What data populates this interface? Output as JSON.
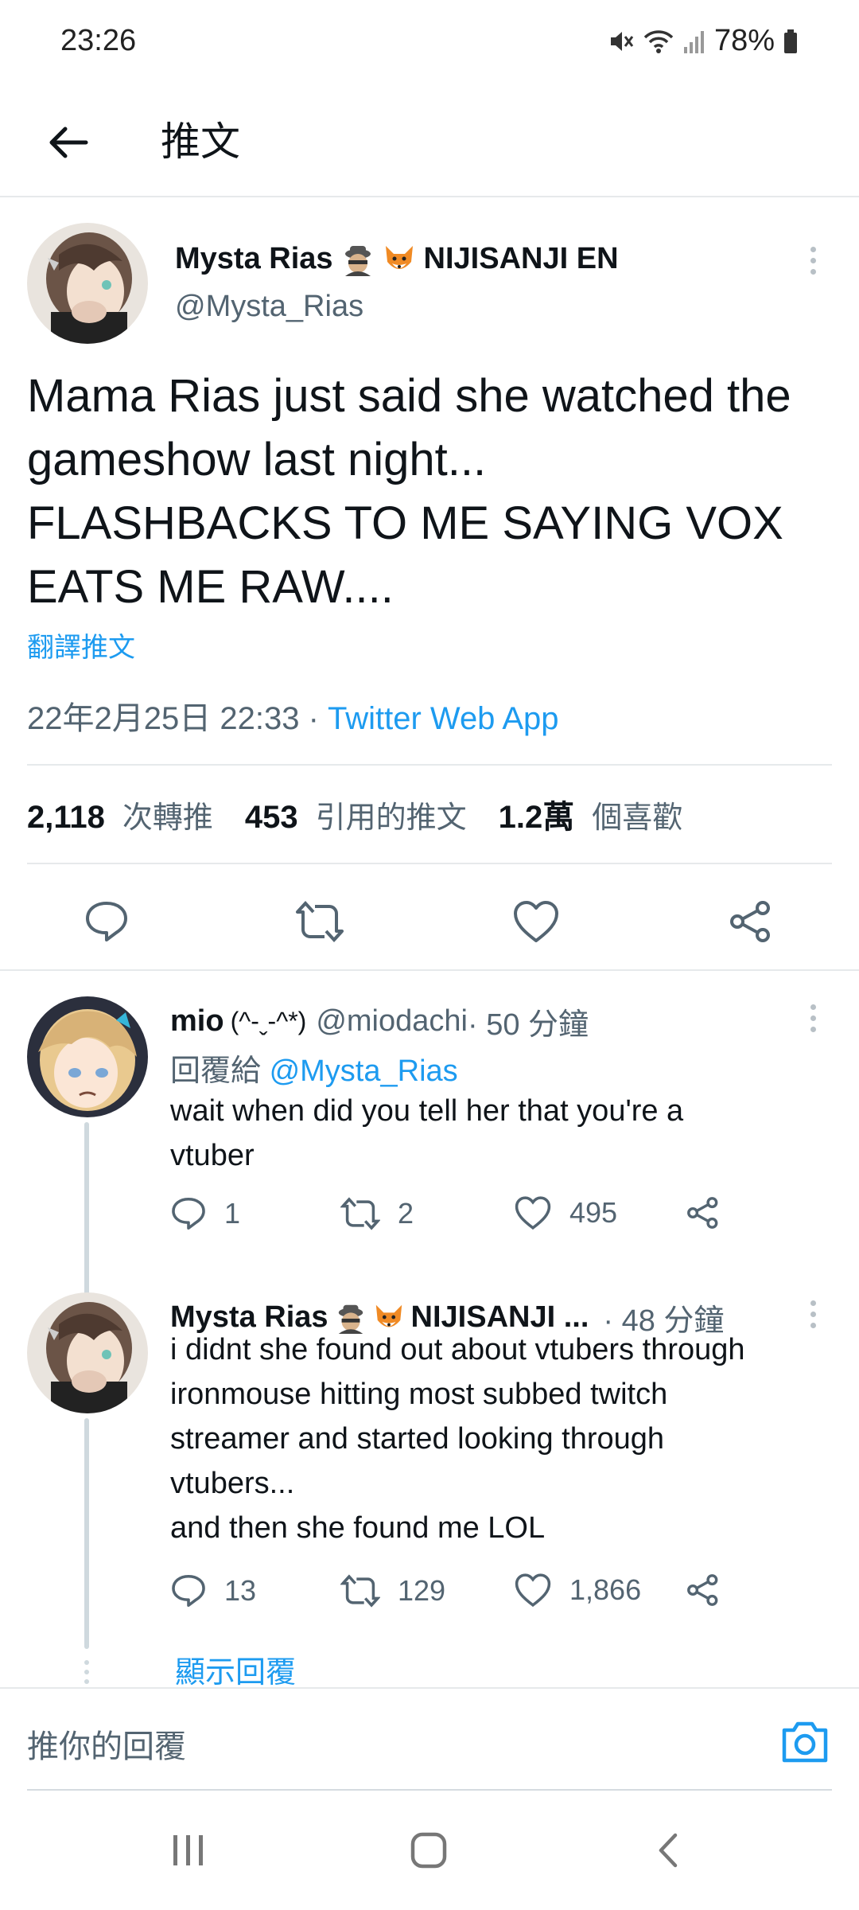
{
  "status_bar": {
    "time": "23:26",
    "battery": "78%",
    "icons": [
      "mute-icon",
      "wifi-icon",
      "signal-icon",
      "battery-icon"
    ]
  },
  "header": {
    "title": "推文"
  },
  "main_tweet": {
    "author_name": "Mysta Rias",
    "author_suffix": "NIJISANJI EN",
    "author_emojis": [
      "spy-emoji",
      "fox-emoji"
    ],
    "handle": "@Mysta_Rias",
    "text": "Mama Rias just said she watched the gameshow last night...\nFLASHBACKS TO ME SAYING VOX EATS ME RAW....",
    "translate_label": "翻譯推文",
    "timestamp": "22年2月25日 22:33",
    "separator": " · ",
    "source": "Twitter Web App",
    "stats": {
      "retweets_count": "2,118",
      "retweets_label": "次轉推",
      "quotes_count": "453",
      "quotes_label": "引用的推文",
      "likes_count": "1.2萬",
      "likes_label": "個喜歡"
    }
  },
  "replies": [
    {
      "name": "mio",
      "name_kaomoji": "(^-ˬ-^*)",
      "handle": "@miodachi",
      "time": " · 50 分鐘",
      "reply_to_label": "回覆給",
      "reply_to_handle": "@Mysta_Rias",
      "text": "wait when did you tell her that you're a\nvtuber",
      "replies": "1",
      "retweets": "2",
      "likes": "495"
    },
    {
      "name": "Mysta Rias",
      "name_suffix": "NIJISANJI ...",
      "handle": "",
      "time": " · 48 分鐘",
      "text": "i didnt she found out about vtubers through\nironmouse hitting most subbed twitch\nstreamer and started looking through\nvtubers...\nand then she found me LOL",
      "replies": "13",
      "retweets": "129",
      "likes": "1,866"
    }
  ],
  "show_replies_label": "顯示回覆",
  "composer": {
    "placeholder": "推你的回覆"
  },
  "colors": {
    "accent": "#1d9bf0",
    "text": "#0f1419",
    "muted": "#536471",
    "divider": "#e6e9eb"
  }
}
